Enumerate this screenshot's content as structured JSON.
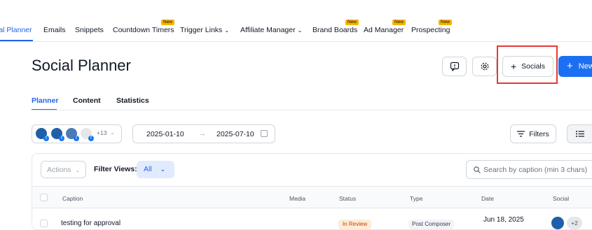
{
  "nav": {
    "items": [
      {
        "label": "ial Planner",
        "active": true
      },
      {
        "label": "Emails"
      },
      {
        "label": "Snippets"
      },
      {
        "label": "Countdown Timers",
        "badge": "New"
      },
      {
        "label": "Trigger Links",
        "has_dropdown": true
      },
      {
        "label": "Affiliate Manager",
        "has_dropdown": true
      },
      {
        "label": "Brand Boards",
        "badge": "New"
      },
      {
        "label": "Ad Manager",
        "badge": "New"
      },
      {
        "label": "Prospecting",
        "badge": "New"
      }
    ]
  },
  "header": {
    "title": "Social Planner",
    "socials_label": "Socials",
    "new_label": "New",
    "plus_glyph": "+"
  },
  "tabs": [
    {
      "label": "Planner",
      "active": true
    },
    {
      "label": "Content"
    },
    {
      "label": "Statistics"
    }
  ],
  "accounts": {
    "more_count": "+13"
  },
  "date_range": {
    "from": "2025-01-10",
    "arrow": "→",
    "to": "2025-07-10"
  },
  "toolbar": {
    "filters_label": "Filters"
  },
  "table_controls": {
    "actions_label": "Actions",
    "filter_views_label": "Filter Views:",
    "all_label": "All",
    "search_placeholder": "Search by caption (min 3 chars)"
  },
  "table": {
    "columns": [
      "Caption",
      "Media",
      "Status",
      "Type",
      "Date",
      "Social"
    ],
    "rows": [
      {
        "caption": "testing for approval",
        "status": "In Review",
        "type": "Post Composer",
        "date": "Jun 18, 2025",
        "social_more": "+2"
      }
    ]
  },
  "colors": {
    "accent": "#2563eb",
    "primary_button": "#1d6ff2",
    "badge": "#f5b400",
    "highlight": "#e53935"
  }
}
